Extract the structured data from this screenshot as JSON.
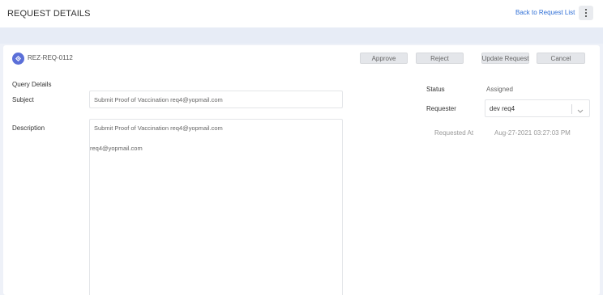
{
  "header": {
    "title": "REQUEST DETAILS",
    "back_link": "Back to Request List",
    "menu_icon": "kebab-menu-icon"
  },
  "request": {
    "icon": "request-tag-icon",
    "id": "REZ-REQ-0112"
  },
  "actions": {
    "approve": "Approve",
    "reject": "Reject",
    "update": "Update Request",
    "cancel": "Cancel"
  },
  "query": {
    "section_title": "Query Details",
    "subject_label": "Subject",
    "subject_value": "Submit Proof of Vaccination req4@yopmail.com",
    "description_label": "Description",
    "description_line1": "Submit Proof of Vaccination req4@yopmail.com",
    "description_line2": "req4@yopmail.com"
  },
  "meta": {
    "status_label": "Status",
    "status_value": "Assigned",
    "requester_label": "Requester",
    "requester_value": "dev req4",
    "requested_at_label": "Requested At",
    "requested_at_value": "Aug-27-2021 03:27:03 PM"
  },
  "colors": {
    "link": "#2f6fd6",
    "icon_bg": "#5b6fd8",
    "page_bg": "#eef1f8"
  }
}
